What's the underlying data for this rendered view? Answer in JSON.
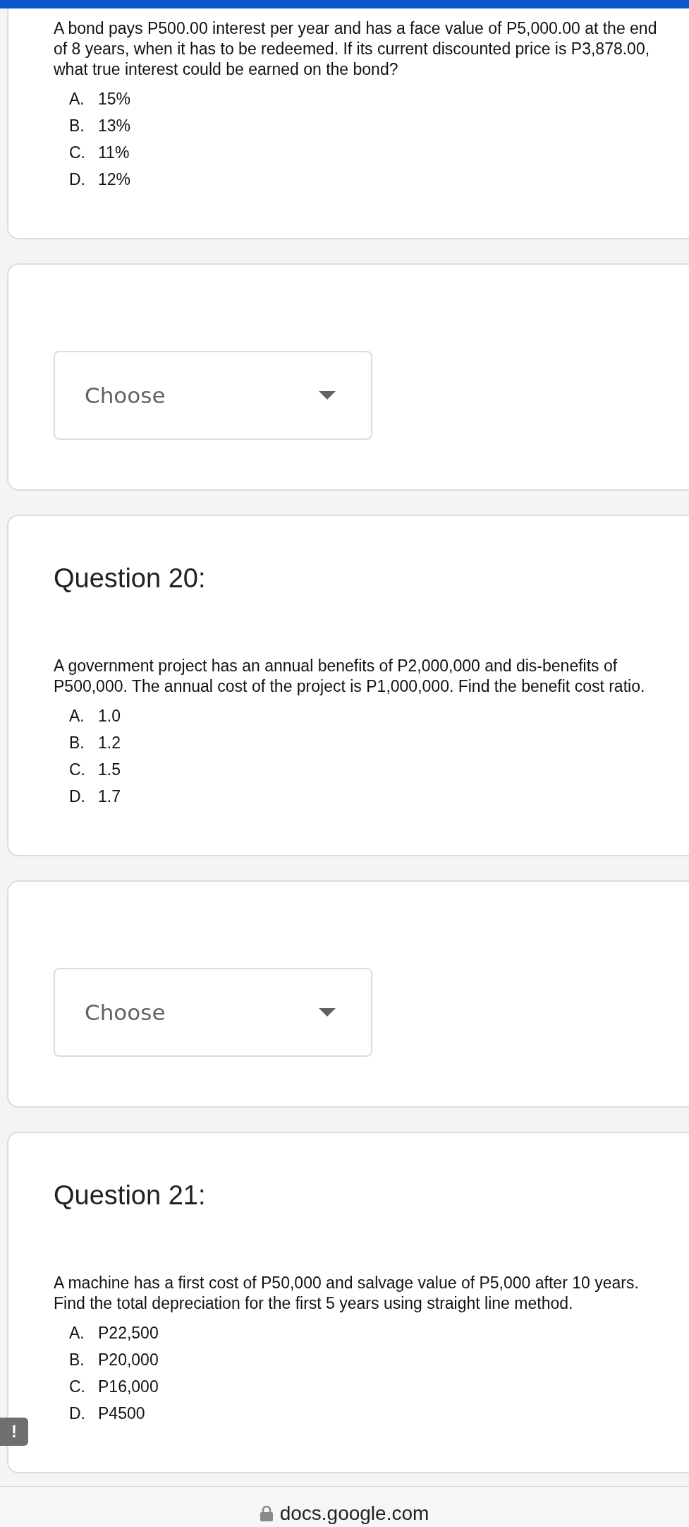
{
  "cards": [
    {
      "kind": "question",
      "text": "A bond pays P500.00 interest per year and has a face value of P5,000.00 at the end of 8 years, when it has to be redeemed. If its current discounted price is P3,878.00, what true interest could be earned on the bond?",
      "options": [
        {
          "letter": "A.",
          "value": "15%"
        },
        {
          "letter": "B.",
          "value": "13%"
        },
        {
          "letter": "C.",
          "value": "11%"
        },
        {
          "letter": "D.",
          "value": "12%"
        }
      ]
    },
    {
      "kind": "dropdown",
      "placeholder": "Choose"
    },
    {
      "kind": "question",
      "heading": "Question 20:",
      "text": "A government project has an annual benefits of P2,000,000 and dis-benefits of P500,000. The annual cost of the project is P1,000,000. Find the benefit cost ratio.",
      "options": [
        {
          "letter": "A.",
          "value": "1.0"
        },
        {
          "letter": "B.",
          "value": "1.2"
        },
        {
          "letter": "C.",
          "value": "1.5"
        },
        {
          "letter": "D.",
          "value": "1.7"
        }
      ]
    },
    {
      "kind": "dropdown",
      "placeholder": "Choose"
    },
    {
      "kind": "question",
      "heading": "Question 21:",
      "text": "A machine has a first cost of P50,000 and salvage value of P5,000 after 10 years. Find the total depreciation for the first 5 years using straight line method.",
      "options": [
        {
          "letter": "A.",
          "value": "P22,500"
        },
        {
          "letter": "B.",
          "value": "P20,000"
        },
        {
          "letter": "C.",
          "value": "P16,000"
        },
        {
          "letter": "D.",
          "value": "P4500"
        }
      ]
    }
  ],
  "feedback_badge": "!",
  "address_bar": {
    "url": "docs.google.com"
  }
}
